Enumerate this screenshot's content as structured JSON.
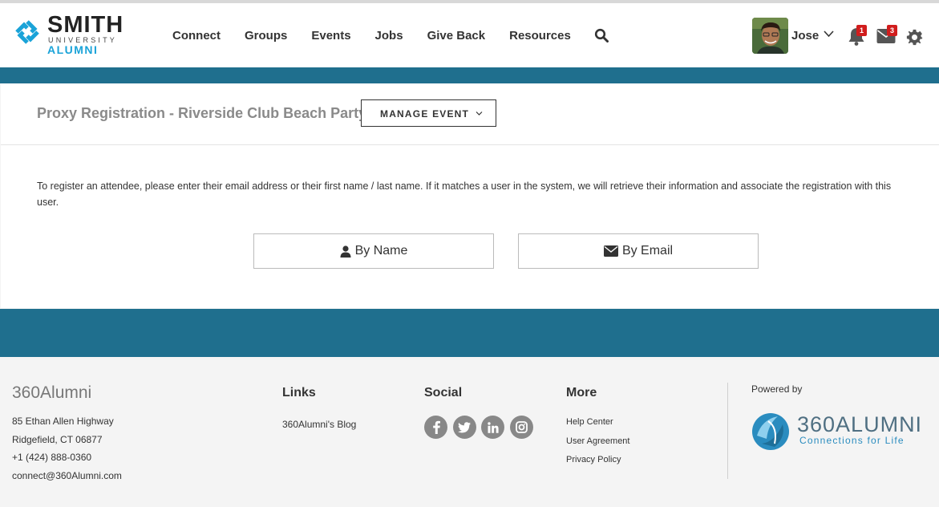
{
  "brand": {
    "name": "SMITH",
    "sub": "UNIVERSITY",
    "tag": "ALUMNI"
  },
  "nav": {
    "items": [
      "Connect",
      "Groups",
      "Events",
      "Jobs",
      "Give Back",
      "Resources"
    ],
    "search_icon": "search-icon"
  },
  "user": {
    "name": "Jose",
    "notifications": "1",
    "messages": "3"
  },
  "page": {
    "title": "Proxy Registration - Riverside Club Beach Party",
    "manage_label": "MANAGE EVENT",
    "intro": "To register an attendee, please enter their email address or their first name / last name. If it matches a user in the system, we will retrieve their information and associate the registration with this user.",
    "by_name": "By Name",
    "by_email": "By Email"
  },
  "footer": {
    "brand": "360Alumni",
    "address_lines": [
      "85 Ethan Allen Highway",
      "Ridgefield, CT 06877",
      "+1 (424) 888-0360",
      "connect@360Alumni.com"
    ],
    "links_heading": "Links",
    "blog_link": "360Alumni's Blog",
    "social_heading": "Social",
    "social_icons": [
      "facebook-icon",
      "twitter-icon",
      "linkedin-icon",
      "instagram-icon"
    ],
    "more_heading": "More",
    "more_links": [
      "Help Center",
      "User Agreement",
      "Privacy Policy"
    ],
    "powered_by": "Powered by",
    "logo_name": "360ALUMNI",
    "logo_tag": "Connections for Life"
  },
  "colors": {
    "band": "#1f6f8e",
    "brand_blue": "#1aa3d8",
    "badge": "#d11d1d"
  }
}
